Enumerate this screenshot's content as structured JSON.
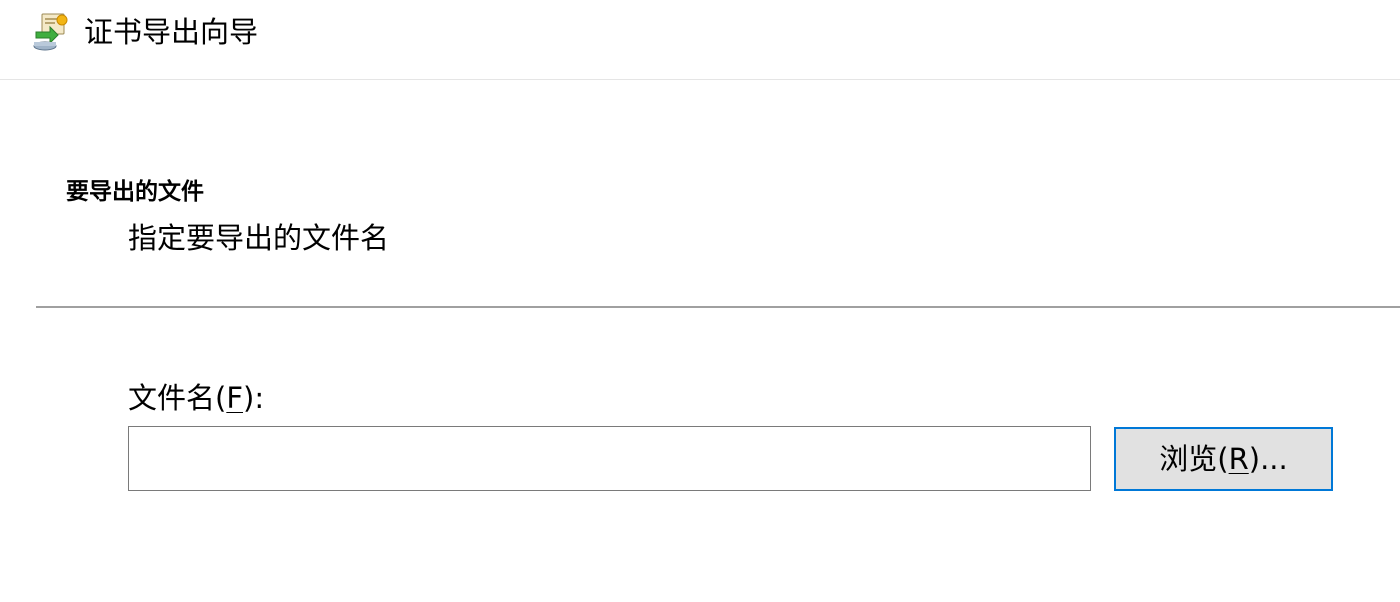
{
  "window": {
    "title": "证书导出向导",
    "icon": "certificate-wizard-icon"
  },
  "section": {
    "heading": "要导出的文件",
    "description": "指定要导出的文件名"
  },
  "file_field": {
    "label_prefix": "文件名(",
    "label_accel": "F",
    "label_suffix": "):",
    "value": "",
    "placeholder": ""
  },
  "browse_button": {
    "label_prefix": "浏览(",
    "label_accel": "R",
    "label_suffix": ")..."
  },
  "colors": {
    "accent": "#0078d7",
    "button_bg": "#e1e1e1",
    "input_border": "#7a7a7a",
    "divider": "#a0a0a0"
  }
}
